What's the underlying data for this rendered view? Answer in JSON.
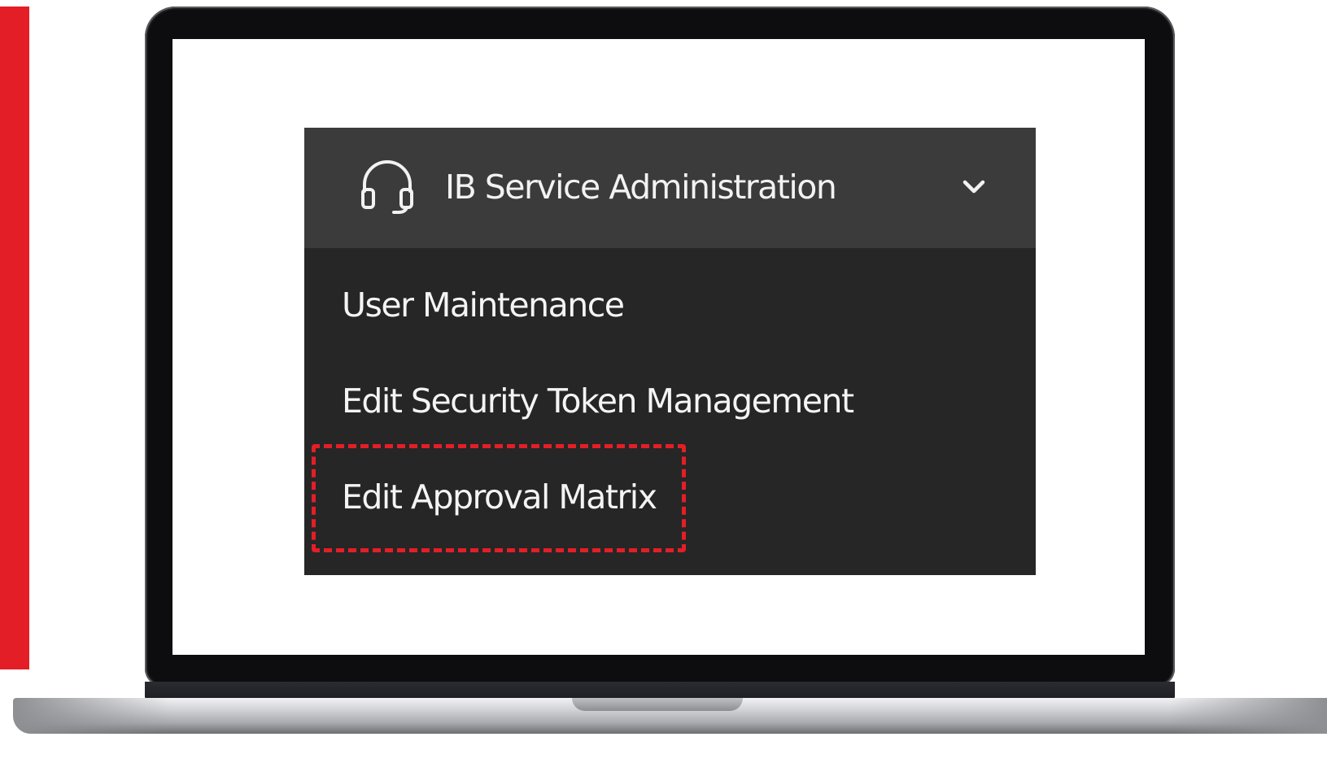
{
  "menu": {
    "header": {
      "icon": "headset-icon",
      "title": "IB Service Administration",
      "toggle_icon": "chevron-down-icon"
    },
    "items": [
      {
        "label": "User Maintenance"
      },
      {
        "label": "Edit Security Token Management"
      },
      {
        "label": "Edit Approval Matrix",
        "highlighted": true
      }
    ]
  },
  "colors": {
    "accent": "#e41e26",
    "header_bg": "#3b3b3b",
    "menu_bg": "#262626",
    "text": "#f2f2f2"
  }
}
